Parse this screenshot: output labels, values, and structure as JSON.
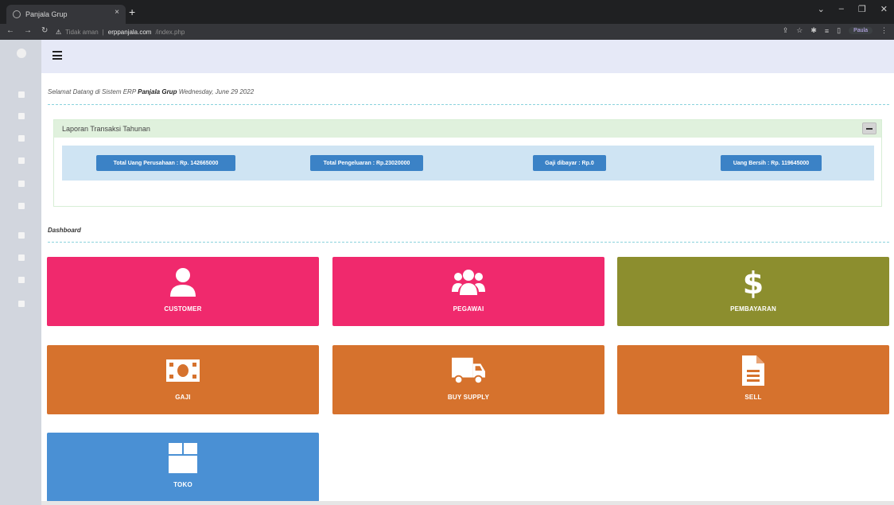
{
  "browser": {
    "tab_title": "Panjala Grup",
    "tab_close": "×",
    "new_tab": "+",
    "url_warning": "Tidak aman",
    "url_host": "erppanjala.com",
    "url_path": "/index.php",
    "profile": "Paula"
  },
  "welcome": {
    "prefix": "Selamat Datang di Sistem ERP",
    "company": "Panjala Grup",
    "date": "Wednesday, June 29 2022"
  },
  "report": {
    "title": "Laporan Transaksi Tahunan",
    "items": [
      {
        "label": "Total Uang Perusahaan : Rp. 142665000"
      },
      {
        "label": "Total Pengeluaran : Rp.23020000"
      },
      {
        "label": "Gaji dibayar : Rp.0"
      },
      {
        "label": "Uang Bersih : Rp. 119645000"
      }
    ]
  },
  "dashboard": {
    "title": "Dashboard",
    "tiles": [
      {
        "label": "CUSTOMER",
        "color": "#f0296d",
        "icon": "user-icon"
      },
      {
        "label": "PEGAWAI",
        "color": "#f0296d",
        "icon": "users-icon"
      },
      {
        "label": "PEMBAYARAN",
        "color": "#8c8e2e",
        "icon": "dollar-icon"
      },
      {
        "label": "GAJI",
        "color": "#d6722d",
        "icon": "money-bill-icon"
      },
      {
        "label": "BUY SUPPLY",
        "color": "#d6722d",
        "icon": "truck-icon"
      },
      {
        "label": "SELL",
        "color": "#d6722d",
        "icon": "file-icon"
      },
      {
        "label": "TOKO",
        "color": "#4a90d4",
        "icon": "box-icon"
      }
    ]
  }
}
